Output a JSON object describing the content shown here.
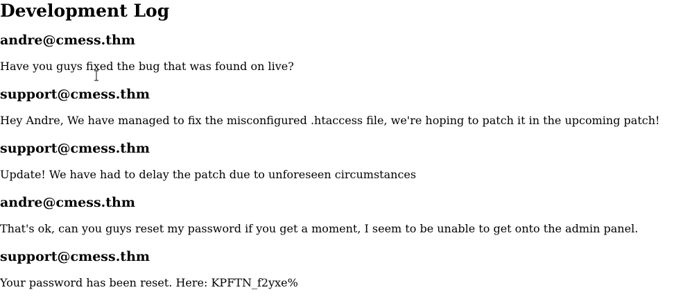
{
  "page": {
    "title": "Development Log"
  },
  "log": {
    "entries": [
      {
        "author": "andre@cmess.thm",
        "message": "Have you guys fixed the bug that was found on live?"
      },
      {
        "author": "support@cmess.thm",
        "message": "Hey Andre, We have managed to fix the misconfigured .htaccess file, we're hoping to patch it in the upcoming patch!"
      },
      {
        "author": "support@cmess.thm",
        "message": "Update! We have had to delay the patch due to unforeseen circumstances"
      },
      {
        "author": "andre@cmess.thm",
        "message": "That's ok, can you guys reset my password if you get a moment, I seem to be unable to get onto the admin panel."
      },
      {
        "author": "support@cmess.thm",
        "message": "Your password has been reset. Here: KPFTN_f2yxe%"
      }
    ]
  },
  "icons": {
    "cursor": "text-cursor-icon"
  }
}
